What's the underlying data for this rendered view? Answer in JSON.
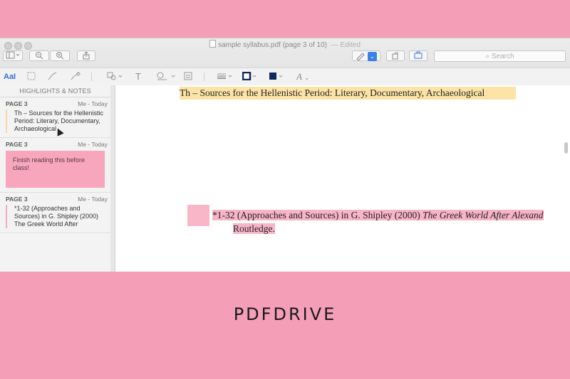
{
  "window": {
    "title": "sample syllabus.pdf (page 3 of 10)",
    "title_status": "— Edited"
  },
  "toolbar": {
    "search_placeholder": "Search",
    "search_icon": "magnifier-icon",
    "zoom_out_icon": "zoom-out-icon",
    "zoom_in_icon": "zoom-in-icon",
    "share_icon": "share-icon",
    "sidebar_icon": "sidebar-icon",
    "pen_icon": "pen-icon",
    "rotate_icon": "rotate-icon",
    "toolbox_icon": "toolbox-icon"
  },
  "markup": {
    "text_style_label": "AaI",
    "text_tool_label": "T",
    "font_label": "A"
  },
  "sidebar": {
    "header": "HIGHLIGHTS & NOTES",
    "notes": [
      {
        "page": "PAGE 3",
        "author": "Me - Today",
        "text": "Th – Sources for the Hellenistic Period: Literary, Documentary, Archaeological"
      },
      {
        "page": "PAGE 3",
        "author": "Me - Today",
        "text": "Finish reading this before class!"
      },
      {
        "page": "PAGE 3",
        "author": "Me - Today",
        "text": "*1-32 (Approaches and Sources) in G. Shipley (2000) The Greek World After"
      }
    ]
  },
  "document": {
    "line1": "Th – Sources for the Hellenistic Period: Literary, Documentary, Archaeological",
    "line2_main": "*1-32 (Approaches and Sources) in G. Shipley (2000) ",
    "line2_italic": "The Greek World After Alexand",
    "line3": "Routledge."
  },
  "branding": {
    "logo_text": "PDFDRIVE"
  },
  "colors": {
    "background": "#f49fb7",
    "highlight_yellow": "#fde4a6",
    "highlight_pink": "#f8b4c8",
    "accent_blue": "#2f6fd6"
  }
}
